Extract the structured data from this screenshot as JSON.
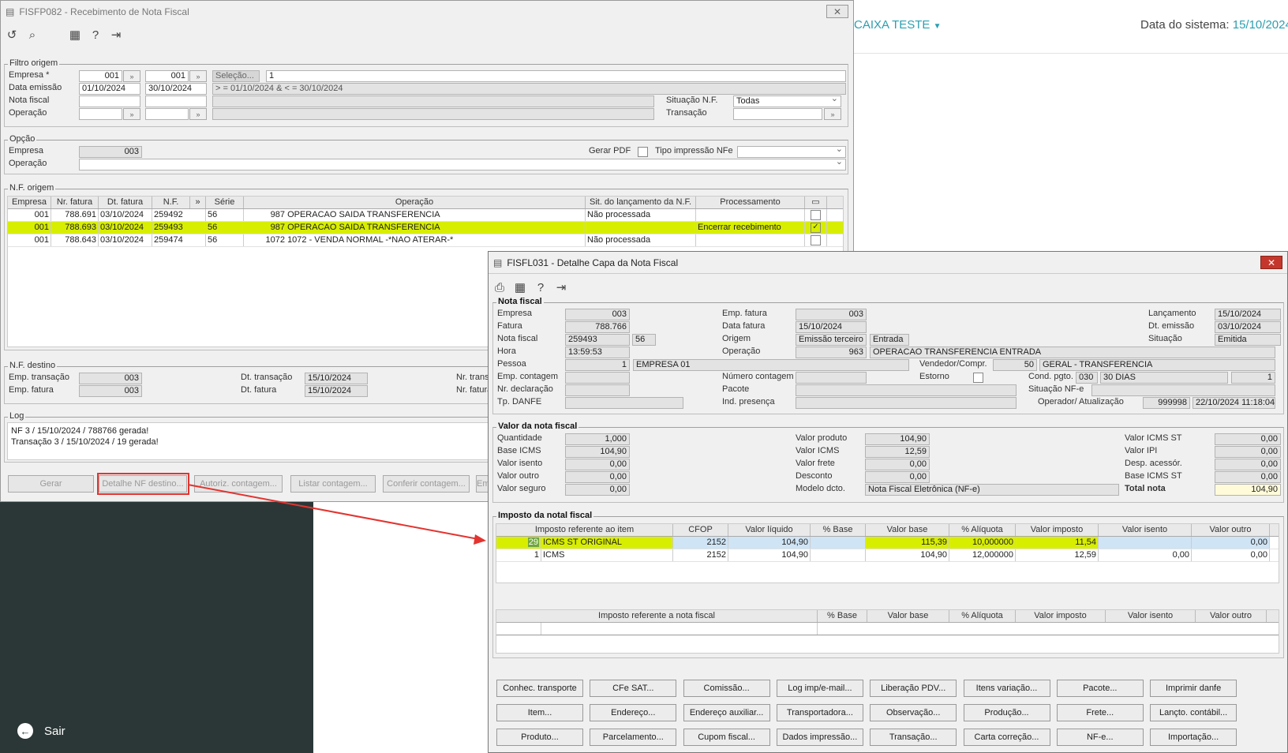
{
  "bg": {
    "caixa": "CAIXA TESTE",
    "data_label": "Data do sistema:",
    "data_value": "15/10/2024",
    "sair": "Sair"
  },
  "w1": {
    "title": "FISFP082 - Recebimento de Nota Fiscal",
    "filtro": {
      "legend": "Filtro origem",
      "empresa_label": "Empresa *",
      "empresa1": "001",
      "empresa2": "001",
      "selecao": "Seleção...",
      "selecao_value": "1",
      "data_label": "Data emissão",
      "data1": "01/10/2024",
      "data2": "30/10/2024",
      "data_expr": "> = 01/10/2024  & < = 30/10/2024",
      "nota_label": "Nota fiscal",
      "operacao_label": "Operação",
      "situacao_label": "Situação N.F.",
      "situacao_value": "Todas",
      "transacao_label": "Transação"
    },
    "opcao": {
      "legend": "Opção",
      "empresa_label": "Empresa",
      "empresa_value": "003",
      "operacao_label": "Operação",
      "gerar_pdf": "Gerar PDF",
      "tipo_impressao": "Tipo impressão NFe"
    },
    "nf_origem": {
      "legend": "N.F. origem",
      "headers": [
        "Empresa",
        "Nr. fatura",
        "Dt. fatura",
        "N.F.",
        "",
        "Série",
        "Operação",
        "Sit. do lançamento da N.F.",
        "Processamento"
      ],
      "rows": [
        {
          "empresa": "001",
          "fatura": "788.691",
          "dt": "03/10/2024",
          "nf": "259492",
          "serie": "56",
          "opcod": "987",
          "operacao": "OPERACAO SAIDA TRANSFERENCIA",
          "sit": "Não processada",
          "proc": "",
          "checked": false
        },
        {
          "empresa": "001",
          "fatura": "788.693",
          "dt": "03/10/2024",
          "nf": "259493",
          "serie": "56",
          "opcod": "987",
          "operacao": "OPERACAO SAIDA TRANSFERENCIA",
          "sit": "",
          "proc": "Encerrar recebimento",
          "checked": true
        },
        {
          "empresa": "001",
          "fatura": "788.643",
          "dt": "03/10/2024",
          "nf": "259474",
          "serie": "56",
          "opcod": "1072",
          "operacao": "1072 - VENDA NORMAL -*NAO ATERAR-*",
          "sit": "Não processada",
          "proc": "",
          "checked": false
        }
      ]
    },
    "nf_destino": {
      "legend": "N.F. destino",
      "emp_transacao_label": "Emp. transação",
      "emp_transacao": "003",
      "emp_fatura_label": "Emp. fatura",
      "emp_fatura": "003",
      "dt_transacao_label": "Dt. transação",
      "dt_transacao": "15/10/2024",
      "dt_fatura_label": "Dt. fatura",
      "dt_fatura": "15/10/2024",
      "nr_label1": "Nr. trans",
      "nr_label2": "Nr. fatura"
    },
    "log": {
      "legend": "Log",
      "line1": "NF 3 / 15/10/2024 / 788766 gerada!",
      "line2": "Transação 3 / 15/10/2024 / 19 gerada!"
    },
    "buttons": {
      "gerar": "Gerar",
      "detalhe": "Detalhe NF destino...",
      "autoriz": "Autoriz. contagem...",
      "listar": "Listar contagem...",
      "conferir": "Conferir contagem...",
      "em": "Em"
    }
  },
  "w2": {
    "title": "FISFL031 - Detalhe Capa da Nota Fiscal",
    "nota": {
      "legend": "Nota fiscal",
      "empresa_label": "Empresa",
      "empresa": "003",
      "fatura_label": "Fatura",
      "fatura": "788.766",
      "nota_label": "Nota fiscal",
      "nota": "259493",
      "serie": "56",
      "hora_label": "Hora",
      "hora": "13:59:53",
      "pessoa_label": "Pessoa",
      "pessoa_cod": "1",
      "pessoa_nome": "EMPRESA 01",
      "emp_contagem_label": "Emp. contagem",
      "nr_declaracao_label": "Nr. declaração",
      "tp_danfe_label": "Tp. DANFE",
      "emp_fatura_label": "Emp. fatura",
      "emp_fatura": "003",
      "data_fatura_label": "Data fatura",
      "data_fatura": "15/10/2024",
      "origem_label": "Origem",
      "origem": "Emissão terceiro",
      "tipo": "Entrada",
      "operacao_label": "Operação",
      "operacao_cod": "963",
      "operacao_nome": "OPERACAO TRANSFERENCIA ENTRADA",
      "vendedor_label": "Vendedor/Compr.",
      "vendedor_cod": "50",
      "vendedor_nome": "GERAL - TRANSFERENCIA",
      "numero_contagem_label": "Número contagem",
      "estorno_label": "Estorno",
      "cond_label": "Cond. pgto.",
      "cond_cod": "030",
      "cond_nome": "30 DIAS",
      "cond_n": "1",
      "pacote_label": "Pacote",
      "situacao_nfe_label": "Situação NF-e",
      "ind_presenca_label": "Ind. presença",
      "operador_label": "Operador/ Atualização",
      "operador": "999998",
      "atualizacao": "22/10/2024 11:18:04",
      "lancamento_label": "Lançamento",
      "lancamento": "15/10/2024",
      "dt_emissao_label": "Dt. emissão",
      "dt_emissao": "03/10/2024",
      "situacao_label": "Situação",
      "situacao": "Emitida"
    },
    "valor": {
      "legend": "Valor da nota fiscal",
      "quantidade_label": "Quantidade",
      "quantidade": "1,000",
      "base_icms_label": "Base ICMS",
      "base_icms": "104,90",
      "valor_isento_label": "Valor isento",
      "valor_isento": "0,00",
      "valor_outro_label": "Valor outro",
      "valor_outro": "0,00",
      "valor_seguro_label": "Valor seguro",
      "valor_seguro": "0,00",
      "valor_produto_label": "Valor produto",
      "valor_produto": "104,90",
      "valor_icms_label": "Valor ICMS",
      "valor_icms": "12,59",
      "valor_frete_label": "Valor frete",
      "valor_frete": "0,00",
      "desconto_label": "Desconto",
      "desconto": "0,00",
      "modelo_label": "Modelo dcto.",
      "modelo": "Nota Fiscal Eletrônica (NF-e)",
      "icms_st_label": "Valor ICMS ST",
      "icms_st": "0,00",
      "ipi_label": "Valor IPI",
      "ipi": "0,00",
      "desp_label": "Desp. acessór.",
      "desp": "0,00",
      "base_st_label": "Base ICMS ST",
      "base_st": "0,00",
      "total_label": "Total nota",
      "total": "104,90"
    },
    "imposto": {
      "legend": "Imposto da notal fiscal",
      "headers": [
        "Imposto referente ao item",
        "CFOP",
        "Valor líquido",
        "% Base",
        "Valor base",
        "% Alíquota",
        "Valor imposto",
        "Valor isento",
        "Valor outro"
      ],
      "rows": [
        {
          "cod": "29",
          "nome": "ICMS ST ORIGINAL",
          "cfop": "2152",
          "liquido": "104,90",
          "base_pct": "",
          "base": "115,39",
          "aliq": "10,000000",
          "imposto": "11,54",
          "isento": "",
          "outro": "0,00"
        },
        {
          "cod": "1",
          "nome": "ICMS",
          "cfop": "2152",
          "liquido": "104,90",
          "base_pct": "",
          "base": "104,90",
          "aliq": "12,000000",
          "imposto": "12,59",
          "isento": "0,00",
          "outro": "0,00"
        }
      ],
      "headers2": [
        "Imposto referente a nota fiscal",
        "% Base",
        "Valor base",
        "% Alíquota",
        "Valor imposto",
        "Valor isento",
        "Valor outro"
      ]
    },
    "buttons": [
      [
        "Conhec. transporte",
        "CFe SAT...",
        "Comissão...",
        "Log imp/e-mail...",
        "Liberação PDV...",
        "Itens variação...",
        "Pacote...",
        "Imprimir danfe"
      ],
      [
        "Item...",
        "Endereço...",
        "Endereço auxiliar...",
        "Transportadora...",
        "Observação...",
        "Produção...",
        "Frete...",
        "Lançto. contábil..."
      ],
      [
        "Produto...",
        "Parcelamento...",
        "Cupom fiscal...",
        "Dados impressão...",
        "Transação...",
        "Carta correção...",
        "NF-e...",
        "Importação..."
      ]
    ]
  }
}
